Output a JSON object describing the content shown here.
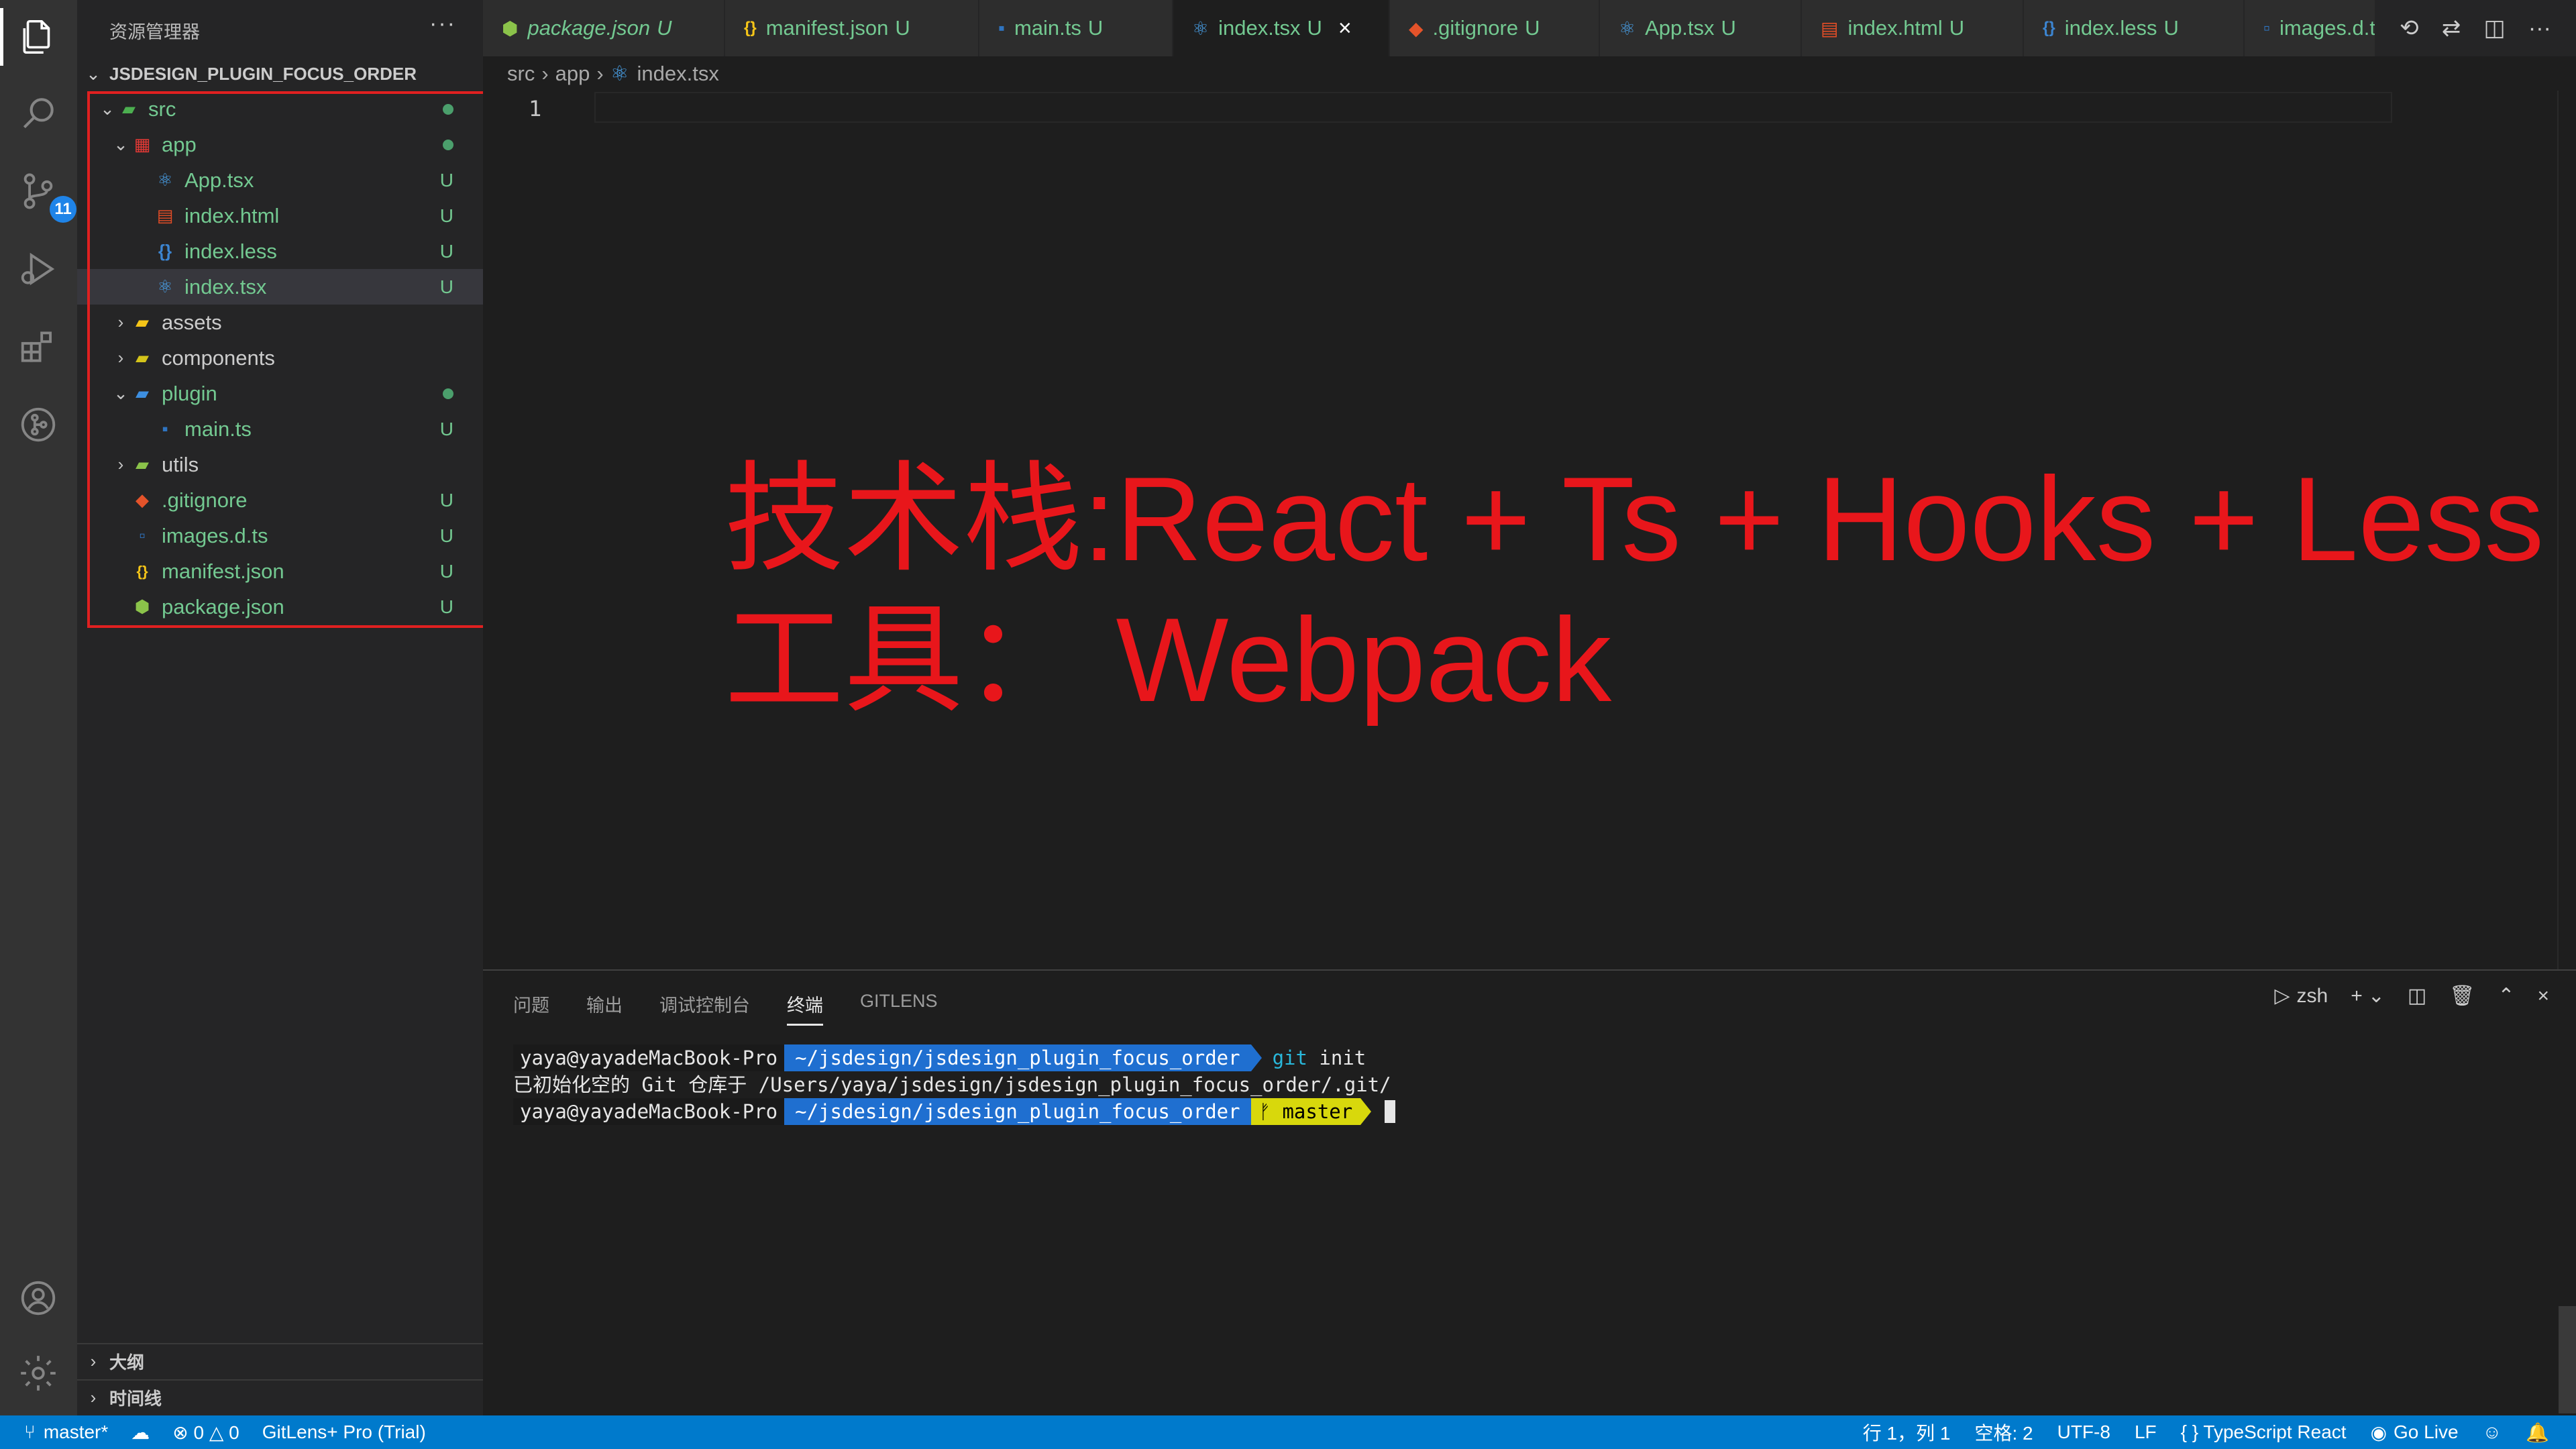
{
  "activity_bar": {
    "icons": [
      "files-icon",
      "search-icon",
      "source-control-icon",
      "run-debug-icon",
      "extensions-icon",
      "gitlens-icon",
      "account-icon",
      "settings-gear-icon"
    ],
    "scm_badge": "11"
  },
  "sidebar": {
    "title": "资源管理器",
    "more": "···",
    "project": "JSDESIGN_PLUGIN_FOCUS_ORDER",
    "tree": [
      {
        "name": "src",
        "icon": "folder-src-icon",
        "level": 0,
        "expanded": true,
        "status": "dot"
      },
      {
        "name": "app",
        "icon": "folder-app-icon",
        "level": 1,
        "expanded": true,
        "status": "dot"
      },
      {
        "name": "App.tsx",
        "icon": "react-icon",
        "level": 2,
        "status": "U"
      },
      {
        "name": "index.html",
        "icon": "html-icon",
        "level": 2,
        "status": "U"
      },
      {
        "name": "index.less",
        "icon": "less-icon",
        "level": 2,
        "status": "U"
      },
      {
        "name": "index.tsx",
        "icon": "react-icon",
        "level": 2,
        "status": "U",
        "selected": true
      },
      {
        "name": "assets",
        "icon": "folder-assets-icon",
        "level": 1,
        "expanded": false
      },
      {
        "name": "components",
        "icon": "folder-components-icon",
        "level": 1,
        "expanded": false
      },
      {
        "name": "plugin",
        "icon": "folder-plugin-icon",
        "level": 1,
        "expanded": true,
        "status": "dot"
      },
      {
        "name": "main.ts",
        "icon": "typescript-icon",
        "level": 2,
        "status": "U"
      },
      {
        "name": "utils",
        "icon": "folder-utils-icon",
        "level": 1,
        "expanded": false
      },
      {
        "name": ".gitignore",
        "icon": "git-icon",
        "level": 0,
        "status": "U"
      },
      {
        "name": "images.d.ts",
        "icon": "typescript-def-icon",
        "level": 0,
        "status": "U"
      },
      {
        "name": "manifest.json",
        "icon": "json-icon",
        "level": 0,
        "status": "U"
      },
      {
        "name": "package.json",
        "icon": "nodejs-icon",
        "level": 0,
        "status": "U"
      }
    ],
    "outline_label": "大纲",
    "timeline_label": "时间线"
  },
  "tabs": [
    {
      "label": "package.json",
      "status": "U",
      "icon": "nodejs-icon",
      "icon_color": "#8bc34a"
    },
    {
      "label": "manifest.json",
      "status": "U",
      "icon": "json-icon",
      "icon_color": "#f5c518"
    },
    {
      "label": "main.ts",
      "status": "U",
      "icon": "typescript-icon",
      "icon_color": "#2f74c0"
    },
    {
      "label": "index.tsx",
      "status": "U",
      "icon": "react-icon",
      "icon_color": "#4aa5f0",
      "active": true
    },
    {
      "label": ".gitignore",
      "status": "U",
      "icon": "git-icon",
      "icon_color": "#e4532a"
    },
    {
      "label": "App.tsx",
      "status": "U",
      "icon": "react-icon",
      "icon_color": "#4aa5f0"
    },
    {
      "label": "index.html",
      "status": "U",
      "icon": "html-icon",
      "icon_color": "#e44d26"
    },
    {
      "label": "index.less",
      "status": "U",
      "icon": "less-icon",
      "icon_color": "#3c85d1"
    },
    {
      "label": "images.d.ts",
      "status": "",
      "icon": "typescript-def-icon",
      "icon_color": "#2f74c0"
    }
  ],
  "breadcrumb": {
    "parts": [
      "src",
      "app",
      "index.tsx"
    ]
  },
  "editor": {
    "line_number": "1",
    "annotation_line1": "技术栈:React + Ts + Hooks + Less",
    "annotation_line2": "工具： Webpack"
  },
  "panel": {
    "tabs": [
      "问题",
      "输出",
      "调试控制台",
      "终端",
      "GITLENS"
    ],
    "active_tab": "终端",
    "shell": "zsh",
    "terminal": {
      "user": "yaya@yayadeMacBook-Pro",
      "path": "~/jsdesign/jsdesign_plugin_focus_order",
      "cmd_git": "git",
      "cmd_rest": " init",
      "output": "已初始化空的 Git 仓库于 /Users/yaya/jsdesign/jsdesign_plugin_focus_order/.git/",
      "branch": "ᚠ master"
    }
  },
  "statusbar": {
    "branch": "master*",
    "errors": "⊗ 0 △ 0",
    "gitlens": "GitLens+ Pro (Trial)",
    "position": "行 1，列 1",
    "spaces": "空格: 2",
    "encoding": "UTF-8",
    "eol": "LF",
    "language": "{ } TypeScript React",
    "golive": "Go Live"
  },
  "colors": {
    "accent": "#007acc",
    "untracked": "#73c991",
    "annotation": "#e8161b"
  }
}
